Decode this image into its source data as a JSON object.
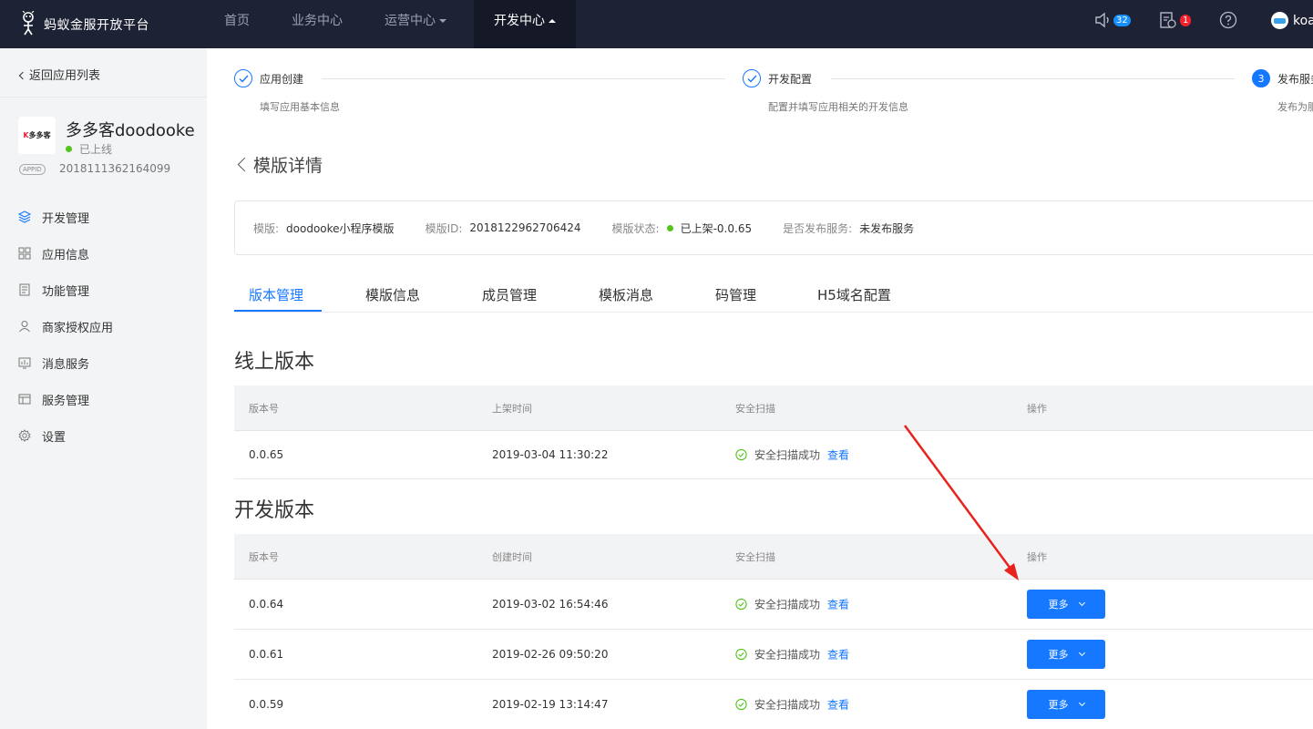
{
  "header": {
    "brand": "蚂蚁金服开放平台",
    "nav": [
      {
        "label": "首页"
      },
      {
        "label": "业务中心"
      },
      {
        "label": "运营中心"
      },
      {
        "label": "开发中心"
      }
    ],
    "notice_count": "32",
    "todo_count": "1",
    "user_name": "koa"
  },
  "sidebar": {
    "back_label": "返回应用列表",
    "app": {
      "name": "多多客doodooke",
      "status": "已上线",
      "appid_tag": "APPID",
      "appid": "2018111362164099"
    },
    "items": [
      {
        "label": "开发管理",
        "icon": "layers-icon"
      },
      {
        "label": "应用信息",
        "icon": "grid-icon"
      },
      {
        "label": "功能管理",
        "icon": "document-icon"
      },
      {
        "label": "商家授权应用",
        "icon": "user-icon"
      },
      {
        "label": "消息服务",
        "icon": "monitor-icon"
      },
      {
        "label": "服务管理",
        "icon": "table-icon"
      },
      {
        "label": "设置",
        "icon": "gear-icon"
      }
    ]
  },
  "steps": [
    {
      "title": "应用创建",
      "desc": "填写应用基本信息"
    },
    {
      "title": "开发配置",
      "desc": "配置并填写应用相关的开发信息"
    },
    {
      "num": "3",
      "title": "发布服务",
      "desc": "发布为服务"
    }
  ],
  "page_title": "模版详情",
  "info": {
    "template_label": "模版:",
    "template_value": "doodooke小程序模版",
    "id_label": "模版ID:",
    "id_value": "2018122962706424",
    "status_label": "模版状态:",
    "status_value": "已上架-0.0.65",
    "publish_label": "是否发布服务:",
    "publish_value": "未发布服务"
  },
  "tabs": [
    {
      "label": "版本管理"
    },
    {
      "label": "模版信息"
    },
    {
      "label": "成员管理"
    },
    {
      "label": "模板消息"
    },
    {
      "label": "码管理"
    },
    {
      "label": "H5域名配置"
    }
  ],
  "online": {
    "title": "线上版本",
    "headers": [
      "版本号",
      "上架时间",
      "安全扫描",
      "操作"
    ],
    "rows": [
      {
        "version": "0.0.65",
        "time": "2019-03-04 11:30:22",
        "scan": "安全扫描成功",
        "view": "查看"
      }
    ]
  },
  "dev": {
    "title": "开发版本",
    "headers": [
      "版本号",
      "创建时间",
      "安全扫描",
      "操作"
    ],
    "rows": [
      {
        "version": "0.0.64",
        "time": "2019-03-02 16:54:46",
        "scan": "安全扫描成功",
        "view": "查看",
        "action": "更多"
      },
      {
        "version": "0.0.61",
        "time": "2019-02-26 09:50:20",
        "scan": "安全扫描成功",
        "view": "查看",
        "action": "更多"
      },
      {
        "version": "0.0.59",
        "time": "2019-02-19 13:14:47",
        "scan": "安全扫描成功",
        "view": "查看",
        "action": "更多"
      }
    ]
  },
  "colors": {
    "nav_bg": "#1e2235",
    "accent": "#1677ff",
    "success": "#52c41a",
    "annotation": "#e8231d"
  }
}
